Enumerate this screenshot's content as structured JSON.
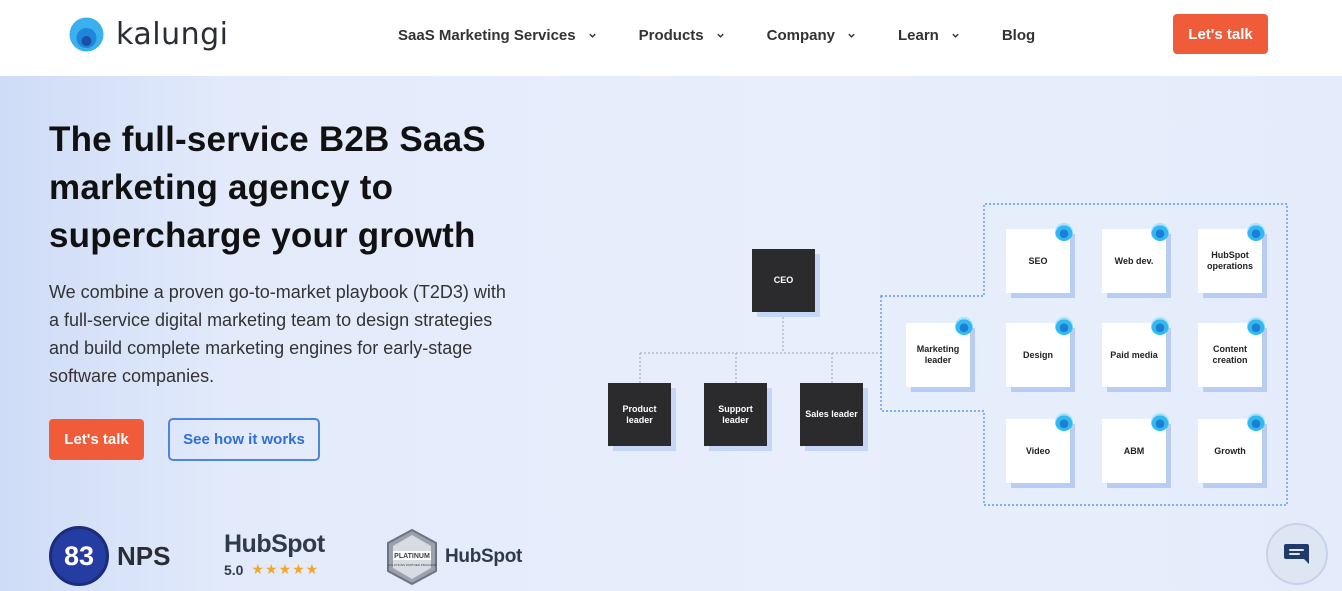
{
  "brand": {
    "name": "kalungi"
  },
  "nav": {
    "items": [
      {
        "label": "SaaS Marketing Services",
        "has_dropdown": true
      },
      {
        "label": "Products",
        "has_dropdown": true
      },
      {
        "label": "Company",
        "has_dropdown": true
      },
      {
        "label": "Learn",
        "has_dropdown": true
      },
      {
        "label": "Blog",
        "has_dropdown": false
      }
    ],
    "cta_label": "Let's talk"
  },
  "hero": {
    "title": "The full-service B2B SaaS marketing agency to supercharge your growth",
    "subtitle": "We combine a proven go-to-market playbook (T2D3) with a full-service digital marketing team to design strategies and build complete marketing engines for early-stage software companies.",
    "primary_cta": "Let's talk",
    "secondary_cta": "See how it works"
  },
  "badges": {
    "nps_score": "83",
    "nps_label": "NPS",
    "hubspot_word": "HubSpot",
    "hubspot_rating": "5.0",
    "hubspot_stars": 5,
    "platinum_badge_text": "PLATINUM",
    "platinum_badge_subtext": "SOLUTIONS PARTNER PROGRAM",
    "hubspot_partner_word": "HubSpot"
  },
  "org_chart": {
    "ceo": "CEO",
    "leaders": [
      "Product leader",
      "Support leader",
      "Sales leader"
    ],
    "marketing_leader": "Marketing leader",
    "team": [
      "SEO",
      "Web dev.",
      "HubSpot operations",
      "Design",
      "Paid media",
      "Content creation",
      "Video",
      "ABM",
      "Growth"
    ]
  },
  "colors": {
    "accent": "#f05c3a",
    "link": "#2f6fd6",
    "dark_box": "#2b2b2e"
  }
}
